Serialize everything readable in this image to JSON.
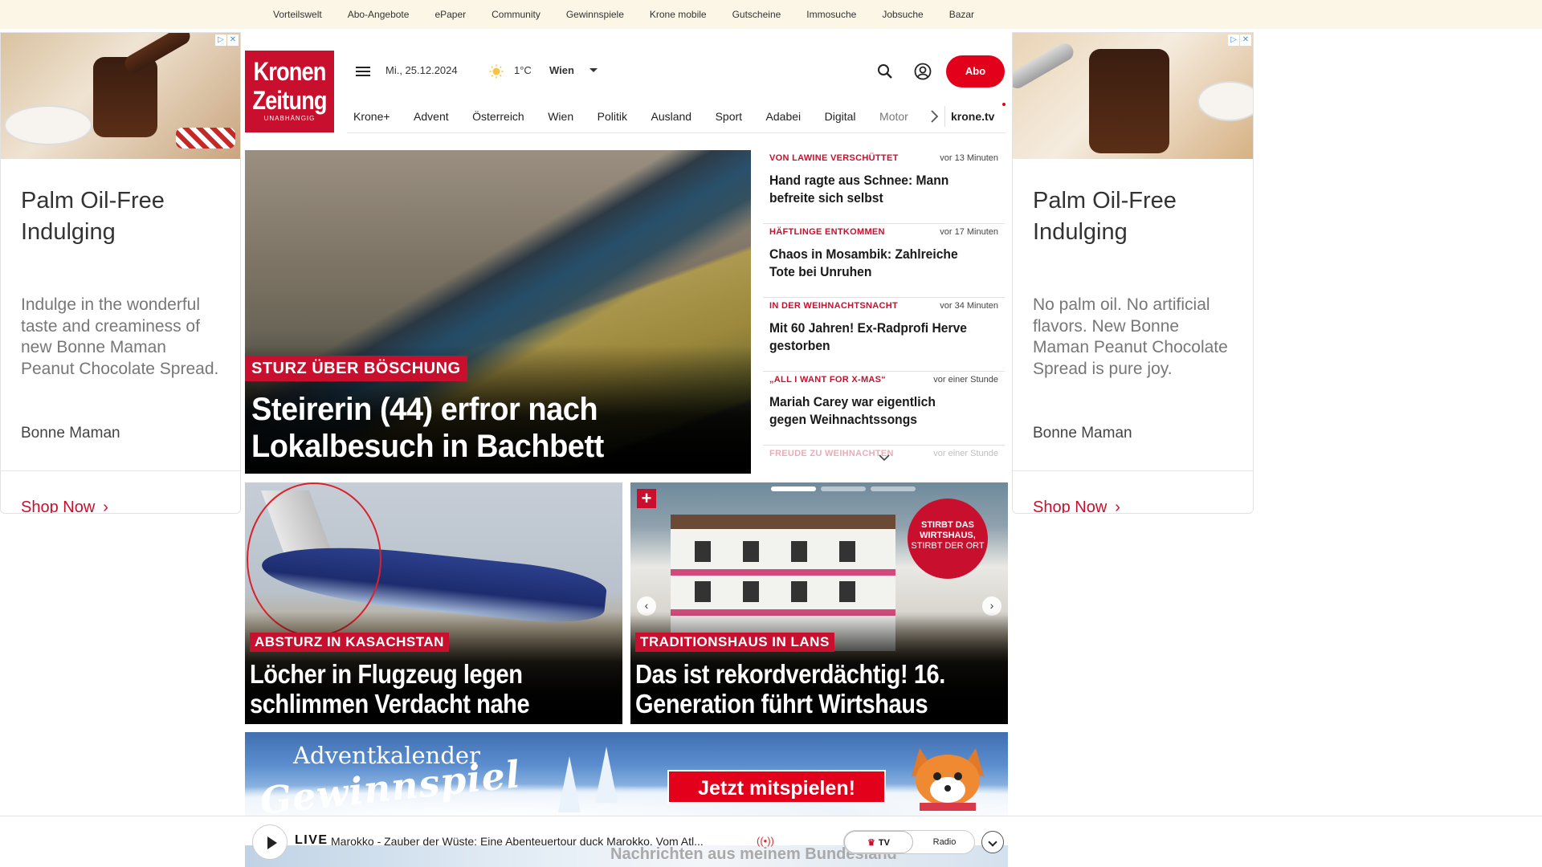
{
  "topbar": {
    "links": [
      "Vorteilswelt",
      "Abo-Angebote",
      "ePaper",
      "Community",
      "Gewinnspiele",
      "Krone mobile",
      "Gutscheine",
      "Immosuche",
      "Jobsuche",
      "Bazar"
    ]
  },
  "ads": {
    "left": {
      "title": "Palm Oil-Free Indulging",
      "text": "Indulge in the wonderful taste and creaminess of new Bonne Maman Peanut Chocolate Spread.",
      "brand": "Bonne Maman",
      "cta": "Shop Now"
    },
    "right": {
      "title": "Palm Oil-Free Indulging",
      "text": "No palm oil. No artificial flavors. New Bonne Maman Peanut Chocolate Spread is pure joy.",
      "brand": "Bonne Maman",
      "cta": "Shop Now"
    },
    "badge": [
      "▷",
      "✕"
    ]
  },
  "header": {
    "logo_line1": "Kronen",
    "logo_line2": "Zeitung",
    "logo_tagline": "UNABHÄNGIG",
    "date": "Mi., 25.12.2024",
    "temperature": "1°C",
    "city": "Wien",
    "abo_label": "Abo"
  },
  "nav": {
    "items": [
      "Krone+",
      "Advent",
      "Österreich",
      "Wien",
      "Politik",
      "Ausland",
      "Sport",
      "Adabei",
      "Digital",
      "Motor"
    ],
    "tv_label": "krone.tv"
  },
  "hero": {
    "kicker": "STURZ ÜBER BÖSCHUNG",
    "headline": "Steirerin (44) erfror nach Lokalbesuch in Bachbett"
  },
  "newslist": [
    {
      "kicker": "VON LAWINE VERSCHÜTTET",
      "time": "vor 13 Minuten",
      "headline": "Hand ragte aus Schnee: Mann befreite sich selbst"
    },
    {
      "kicker": "HÄFTLINGE ENTKOMMEN",
      "time": "vor 17 Minuten",
      "headline": "Chaos in Mosambik: Zahlreiche Tote bei Unruhen"
    },
    {
      "kicker": "IN DER WEIHNACHTSNACHT",
      "time": "vor 34 Minuten",
      "headline": "Mit 60 Jahren! Ex-Radprofi Herve gestorben"
    },
    {
      "kicker": "„ALL I WANT FOR X-MAS“",
      "time": "vor einer Stunde",
      "headline": "Mariah Carey war eigentlich gegen Weihnachtssongs"
    },
    {
      "kicker": "FREUDE ZU WEIHNACHTEN",
      "time": "vor einer Stunde",
      "headline": ""
    }
  ],
  "teasers": [
    {
      "kicker": "ABSTURZ IN KASACHSTAN",
      "headline": "Löcher in Flugzeug legen schlimmen Verdacht nahe"
    },
    {
      "kicker": "TRADITIONSHAUS IN LANS",
      "headline": "Das ist rekordverdächtig! 16. Generation führt Wirtshaus",
      "badge_bold": "STIRBT DAS WIRTSHAUS,",
      "badge_rest": "STIRBT DER ORT",
      "plus": "+"
    }
  ],
  "advent": {
    "line1": "Adventkalender",
    "line2": "Gewinnspiel",
    "cta": "Jetzt mitspielen!"
  },
  "livebar": {
    "live_label": "LIVE",
    "title": "Marokko - Zauber der Wüste: Eine Abenteuertour duck Marokko. Vom Atl...",
    "tv_label": "TV",
    "radio_label": "Radio",
    "under_text": "Nachrichten aus meinem Bundesland"
  },
  "colors": {
    "brand_red": "#c8102e",
    "abo_red": "#e3001b",
    "topbar_bg": "#fbf6e6"
  }
}
